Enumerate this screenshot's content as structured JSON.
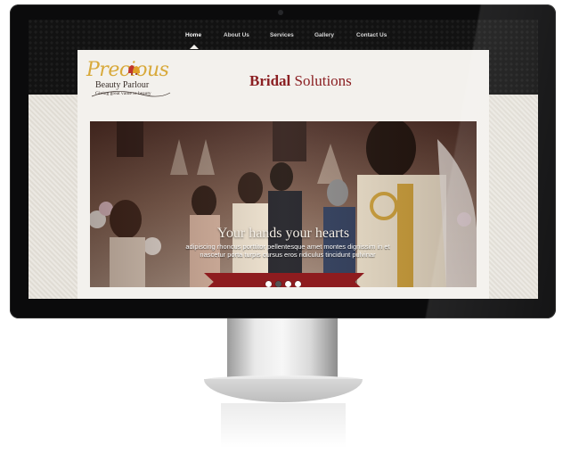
{
  "nav": {
    "items": [
      {
        "label": "Home",
        "active": true
      },
      {
        "label": "About Us",
        "active": false
      },
      {
        "label": "Services",
        "active": false
      },
      {
        "label": "Gallery",
        "active": false
      },
      {
        "label": "Contact Us",
        "active": false
      }
    ]
  },
  "logo": {
    "script": "Precious",
    "name": "Beauty Parlour",
    "tagline": "Giving great value to beauty",
    "icon": "bells-icon"
  },
  "header": {
    "title_bold": "Bridal",
    "title_rest": "Solutions"
  },
  "slider": {
    "caption_title": "Your hands your hearts",
    "caption_body": "adipiscing rhoncus porttitor pellentesque amet montes dignissim in et nascetur porta turpis cursus eros ridiculus tincidunt pulvinar",
    "dots": 4,
    "active_dot": 1
  },
  "colors": {
    "brand_red": "#8b1f22",
    "logo_gold": "#d8a93a",
    "bezel": "#0b0b0c"
  }
}
